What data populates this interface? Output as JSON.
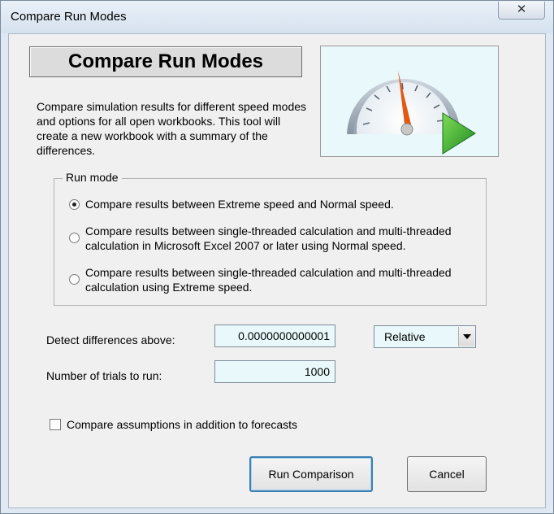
{
  "window": {
    "title": "Compare Run Modes",
    "close_label": "✕"
  },
  "header": {
    "title": "Compare Run Modes",
    "description": "Compare simulation results for different speed modes and options for all open workbooks.  This tool will create a new workbook with a summary of the differences."
  },
  "icons": {
    "gauge": "speedometer-gauge-icon",
    "play": "green-play-arrow-icon"
  },
  "run_mode": {
    "label": "Run mode",
    "selected_index": 0,
    "options": [
      {
        "label": "Compare results between Extreme speed and Normal speed."
      },
      {
        "label": "Compare results between single-threaded calculation and multi-threaded calculation in Microsoft Excel 2007 or later using Normal speed."
      },
      {
        "label": "Compare results between single-threaded calculation and multi-threaded calculation using Extreme speed."
      }
    ]
  },
  "detect": {
    "label": "Detect differences above:",
    "value": "0.0000000000001",
    "mode_value": "Relative"
  },
  "trials": {
    "label": "Number of trials to run:",
    "value": "1000"
  },
  "assumptions": {
    "label": "Compare assumptions in addition to forecasts",
    "checked": false
  },
  "buttons": {
    "run_label": "Run Comparison",
    "cancel_label": "Cancel"
  },
  "colors": {
    "input_background": "#e8f8fb",
    "needle": "#e05a14",
    "play_arrow": "#3aa832"
  }
}
